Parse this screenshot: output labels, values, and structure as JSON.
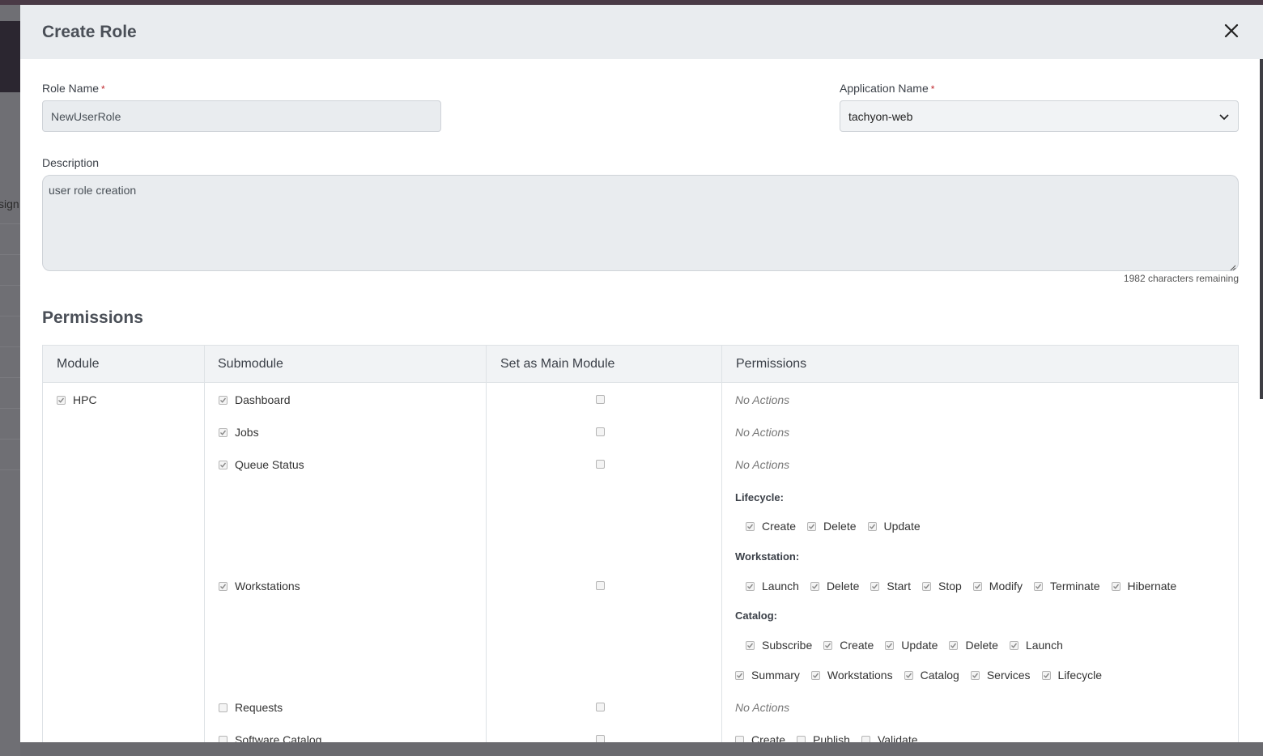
{
  "modal": {
    "title": "Create Role"
  },
  "form": {
    "role_name": {
      "label": "Role Name",
      "required_mark": "*",
      "value": "NewUserRole"
    },
    "application_name": {
      "label": "Application Name",
      "required_mark": "*",
      "value": "tachyon-web"
    },
    "description": {
      "label": "Description",
      "value": "user role creation",
      "remaining": "1982 characters remaining"
    }
  },
  "permissions": {
    "title": "Permissions",
    "headers": [
      "Module",
      "Submodule",
      "Set as Main Module",
      "Permissions"
    ],
    "module": {
      "label": "HPC",
      "checked": true
    },
    "rows": [
      {
        "submodule": "Dashboard",
        "checked": true,
        "main": false,
        "perm_text": "No Actions"
      },
      {
        "submodule": "Jobs",
        "checked": true,
        "main": false,
        "perm_text": "No Actions"
      },
      {
        "submodule": "Queue Status",
        "checked": true,
        "main": false,
        "perm_text": "No Actions"
      },
      {
        "submodule": "Workstations",
        "checked": true,
        "main": false,
        "groups": [
          {
            "name": "Lifecycle:",
            "actions": [
              "Create",
              "Delete",
              "Update"
            ]
          },
          {
            "name": "Workstation:",
            "actions": [
              "Launch",
              "Delete",
              "Start",
              "Stop",
              "Modify",
              "Terminate",
              "Hibernate"
            ]
          },
          {
            "name": "Catalog:",
            "actions": [
              "Subscribe",
              "Create",
              "Update",
              "Delete",
              "Launch"
            ]
          }
        ],
        "tabs": [
          "Summary",
          "Workstations",
          "Catalog",
          "Services",
          "Lifecycle"
        ]
      },
      {
        "submodule": "Requests",
        "checked": false,
        "main": false,
        "perm_text": "No Actions"
      },
      {
        "submodule": "Software Catalog",
        "checked": false,
        "main": false,
        "actions": [
          "Create",
          "Publish",
          "Validate"
        ]
      }
    ]
  },
  "background": {
    "side_text": "sign"
  },
  "icons": {
    "close": "close-icon",
    "dropdown": "chevron-down-icon",
    "checkbox": "checkbox-icon"
  },
  "colors": {
    "header_bg": "#e9ecef",
    "required": "#c0272d",
    "title": "#4a4f57"
  }
}
